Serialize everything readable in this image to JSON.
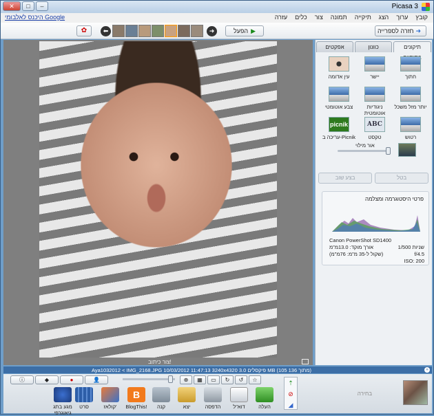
{
  "window": {
    "title": "Picasa 3"
  },
  "menu": [
    "קובץ",
    "ערוך",
    "הצג",
    "תיקייה",
    "תמונה",
    "צור",
    "כלים",
    "עזרה"
  ],
  "google_link": "היכנס לאלבומי Google",
  "toolbar": {
    "back_label": "חזרה לספרייה",
    "play_label": "הפעל"
  },
  "tabs": {
    "basic": "תיקונים בסיסיים",
    "tuning": "כוונון",
    "effects": "אפקטים"
  },
  "tools": [
    {
      "label": "חתוך"
    },
    {
      "label": "יישר"
    },
    {
      "label": "עין אדומה"
    },
    {
      "label": "יותר מזל משכל"
    },
    {
      "label": "ניגודיות אוטומטית"
    },
    {
      "label": "צבע אוטומטי"
    },
    {
      "label": "רטוש"
    },
    {
      "label": "טקסט"
    },
    {
      "label": "עריכה ב-Picnik"
    }
  ],
  "fill_light_label": "אור מילוי",
  "panel_buttons": {
    "undo": "בטל",
    "redo": "בצע שוב"
  },
  "histogram": {
    "title": "פרטי היסטוגרמה ומצלמה",
    "camera": "Canon PowerShot SD1400",
    "focal": "אורך מוקד: 13.0מ\"מ",
    "equiv": "(שקול ל-35 מ\"מ: 76מ\"מ)",
    "shutter_label": "שניות",
    "shutter": "1/500",
    "aperture": "f/4.5",
    "iso": "ISO: 200"
  },
  "caption": "צור כיתוב!",
  "status": "Aya1032012 < IMG_2168.JPG   10/03/2012  11:47:13   3240x4320 פיקסלים   3.0 MB   (105 מתוך 136)",
  "tray": {
    "label": "בחירה"
  },
  "actions": [
    "העלה",
    "דוא\"ל",
    "הדפסה",
    "יצא",
    "קנה",
    "BlogThis!",
    "קולאז'",
    "סרט",
    "מגע בתג גיאוגרפי"
  ]
}
